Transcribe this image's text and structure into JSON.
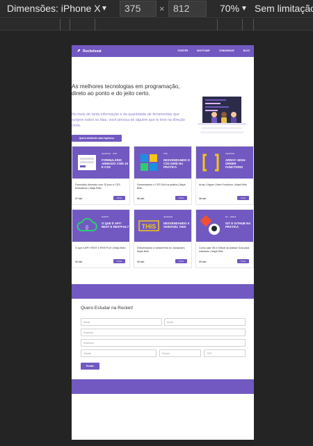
{
  "devtools": {
    "device_label": "Dimensões: iPhone X",
    "width_value": "375",
    "height_value": "812",
    "times_symbol": "×",
    "zoom": "70%",
    "throttling": "Sem limitação"
  },
  "site": {
    "brand": "Rocketseat",
    "nav": [
      "STARTER",
      "BOOTCAMP",
      "COMUNIDADE",
      "BLOG"
    ],
    "hero": {
      "title": "As melhores tecnologias em programação, direto ao ponto e do jeito certo.",
      "subtitle": "No meio de tanta informação e da quantidade de ferramentas que surgem todos os dias, você precisa de alguém que te leve na direção certa.",
      "cta": "Quero ambiente mais higiênico"
    },
    "cards": [
      {
        "title": "FORMULÁRIO ANIMADO COM JS E CSS",
        "tags": [
          "JavaScript",
          "CSS"
        ],
        "desc": "Formulário Animado com JS puro e CSS Animations | Mayk Brito",
        "meta": "37 min",
        "button": "Vírus"
      },
      {
        "title": "DESVENDANDO O CSS GRID NA PRÁTICA",
        "tags": [
          "CSS"
        ],
        "desc": "Desvendando o CSS Grid na prática | Mayk Brito",
        "meta": "56 min",
        "button": "Vírus"
      },
      {
        "title": "ARRAY: HIGH-ORDER FUNCTIONS",
        "tags": [
          "JavaScript"
        ],
        "desc": "Array | Higher Order Functions | Mayk Brito",
        "meta": "36 min",
        "button": "Vírus"
      },
      {
        "title": "O QUE É API? REST E RESTFUL?",
        "tags": [
          "NodeJS"
        ],
        "desc": "O que é API? REST e RESTFul? | Mayk Brito",
        "meta": "32 min",
        "button": "Vírus"
      },
      {
        "title": "DESVENDANDO A VARIÁVEL THIS",
        "tags": [
          "JavaScript"
        ],
        "desc": "Desvendando a variável this no Javascript | Mayk Brito",
        "meta": "33 min",
        "button": "Vírus"
      },
      {
        "title": "GIT E GITHUB NA PRÁTICA",
        "tags": [
          "Git",
          "GitHub"
        ],
        "desc": "Como usar Git e Github na prática! Guia para iniciantes | Mayk Brito",
        "meta": "33 min",
        "button": "Vírus"
      }
    ],
    "form": {
      "title": "Quero Estudar na Rocket!",
      "placeholders": {
        "name": "Nome",
        "email": "Email",
        "company": "Empresa",
        "address": "Endereço",
        "city": "Cidade",
        "state": "Estado",
        "cep": "CEP"
      },
      "submit": "Enviar"
    }
  },
  "colors": {
    "accent": "#7159c1",
    "devtools_bg": "#242424"
  }
}
